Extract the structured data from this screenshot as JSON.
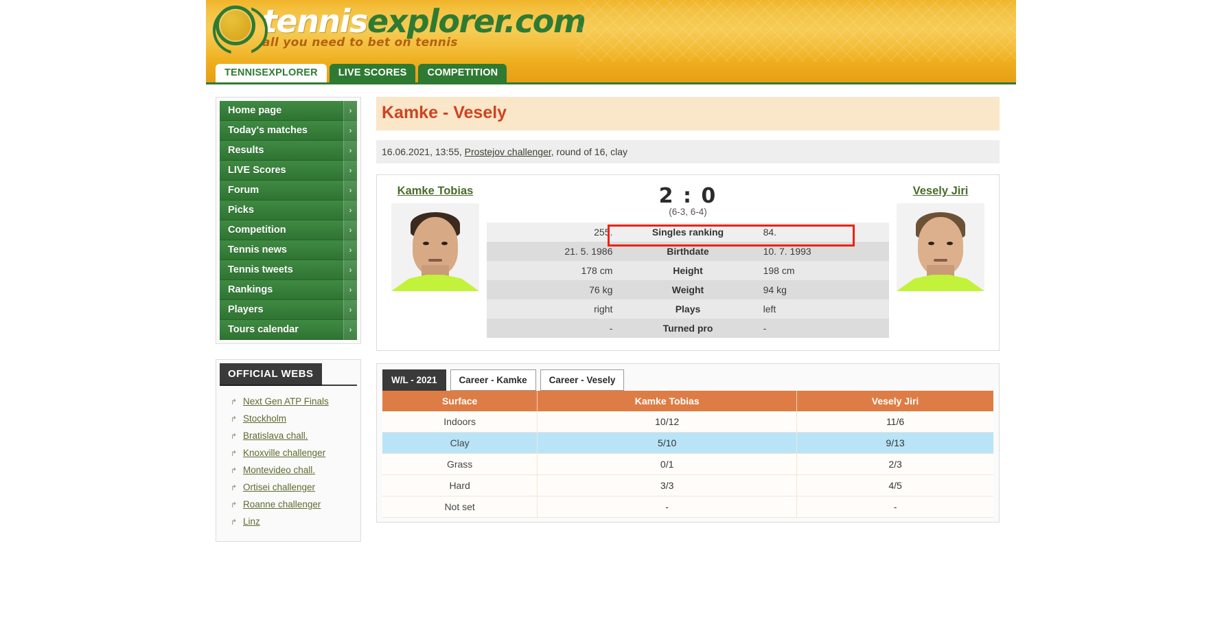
{
  "site": {
    "logo_text_white": "tennis",
    "logo_text_green": "explorer.com",
    "tagline": "all you need to bet on tennis"
  },
  "nav": {
    "tabs": [
      {
        "label": "TENNISEXPLORER",
        "active": true
      },
      {
        "label": "LIVE SCORES",
        "active": false
      },
      {
        "label": "COMPETITION",
        "active": false
      }
    ]
  },
  "sidebar": {
    "menu": [
      {
        "label": "Home page"
      },
      {
        "label": "Today's matches"
      },
      {
        "label": "Results"
      },
      {
        "label": "LIVE Scores"
      },
      {
        "label": "Forum"
      },
      {
        "label": "Picks"
      },
      {
        "label": "Competition"
      },
      {
        "label": "Tennis news"
      },
      {
        "label": "Tennis tweets"
      },
      {
        "label": "Rankings"
      },
      {
        "label": "Players"
      },
      {
        "label": "Tours calendar"
      }
    ],
    "arrow_glyph": "›",
    "official_webs": {
      "title": "OFFICIAL WEBS",
      "external_icon": "↱",
      "links": [
        "Next Gen ATP Finals",
        "Stockholm",
        "Bratislava chall.",
        "Knoxville challenger",
        "Montevideo chall.",
        "Ortisei challenger",
        "Roanne challenger",
        "Linz"
      ]
    }
  },
  "match": {
    "title": "Kamke - Vesely",
    "meta_prefix": "16.06.2021, 13:55, ",
    "meta_link": "Prostejov challenger",
    "meta_suffix": ", round of 16, clay",
    "score": "2 : 0",
    "sets": "(6-3, 6-4)",
    "player_left": "Kamke Tobias",
    "player_right": "Vesely Jiri",
    "stats": [
      {
        "left": "255.",
        "label": "Singles ranking",
        "right": "84.",
        "highlighted": true
      },
      {
        "left": "21. 5. 1986",
        "label": "Birthdate",
        "right": "10. 7. 1993",
        "highlighted": false
      },
      {
        "left": "178 cm",
        "label": "Height",
        "right": "198 cm",
        "highlighted": false
      },
      {
        "left": "76 kg",
        "label": "Weight",
        "right": "94 kg",
        "highlighted": false
      },
      {
        "left": "right",
        "label": "Plays",
        "right": "left",
        "highlighted": false
      },
      {
        "left": "-",
        "label": "Turned pro",
        "right": "-",
        "highlighted": false
      }
    ],
    "highlight_color": "#ee2211"
  },
  "wl": {
    "tabs": [
      {
        "label": "W/L - 2021",
        "active": true
      },
      {
        "label": "Career - Kamke",
        "active": false
      },
      {
        "label": "Career - Vesely",
        "active": false
      }
    ],
    "table": {
      "headers": [
        "Surface",
        "Kamke Tobias",
        "Vesely Jiri"
      ],
      "rows": [
        {
          "surface": "Indoors",
          "kamke": "10/12",
          "vesely": "11/6",
          "highlighted": false
        },
        {
          "surface": "Clay",
          "kamke": "5/10",
          "vesely": "9/13",
          "highlighted": true
        },
        {
          "surface": "Grass",
          "kamke": "0/1",
          "vesely": "2/3",
          "highlighted": false
        },
        {
          "surface": "Hard",
          "kamke": "3/3",
          "vesely": "4/5",
          "highlighted": false
        },
        {
          "surface": "Not set",
          "kamke": "-",
          "vesely": "-",
          "highlighted": false
        }
      ]
    }
  }
}
